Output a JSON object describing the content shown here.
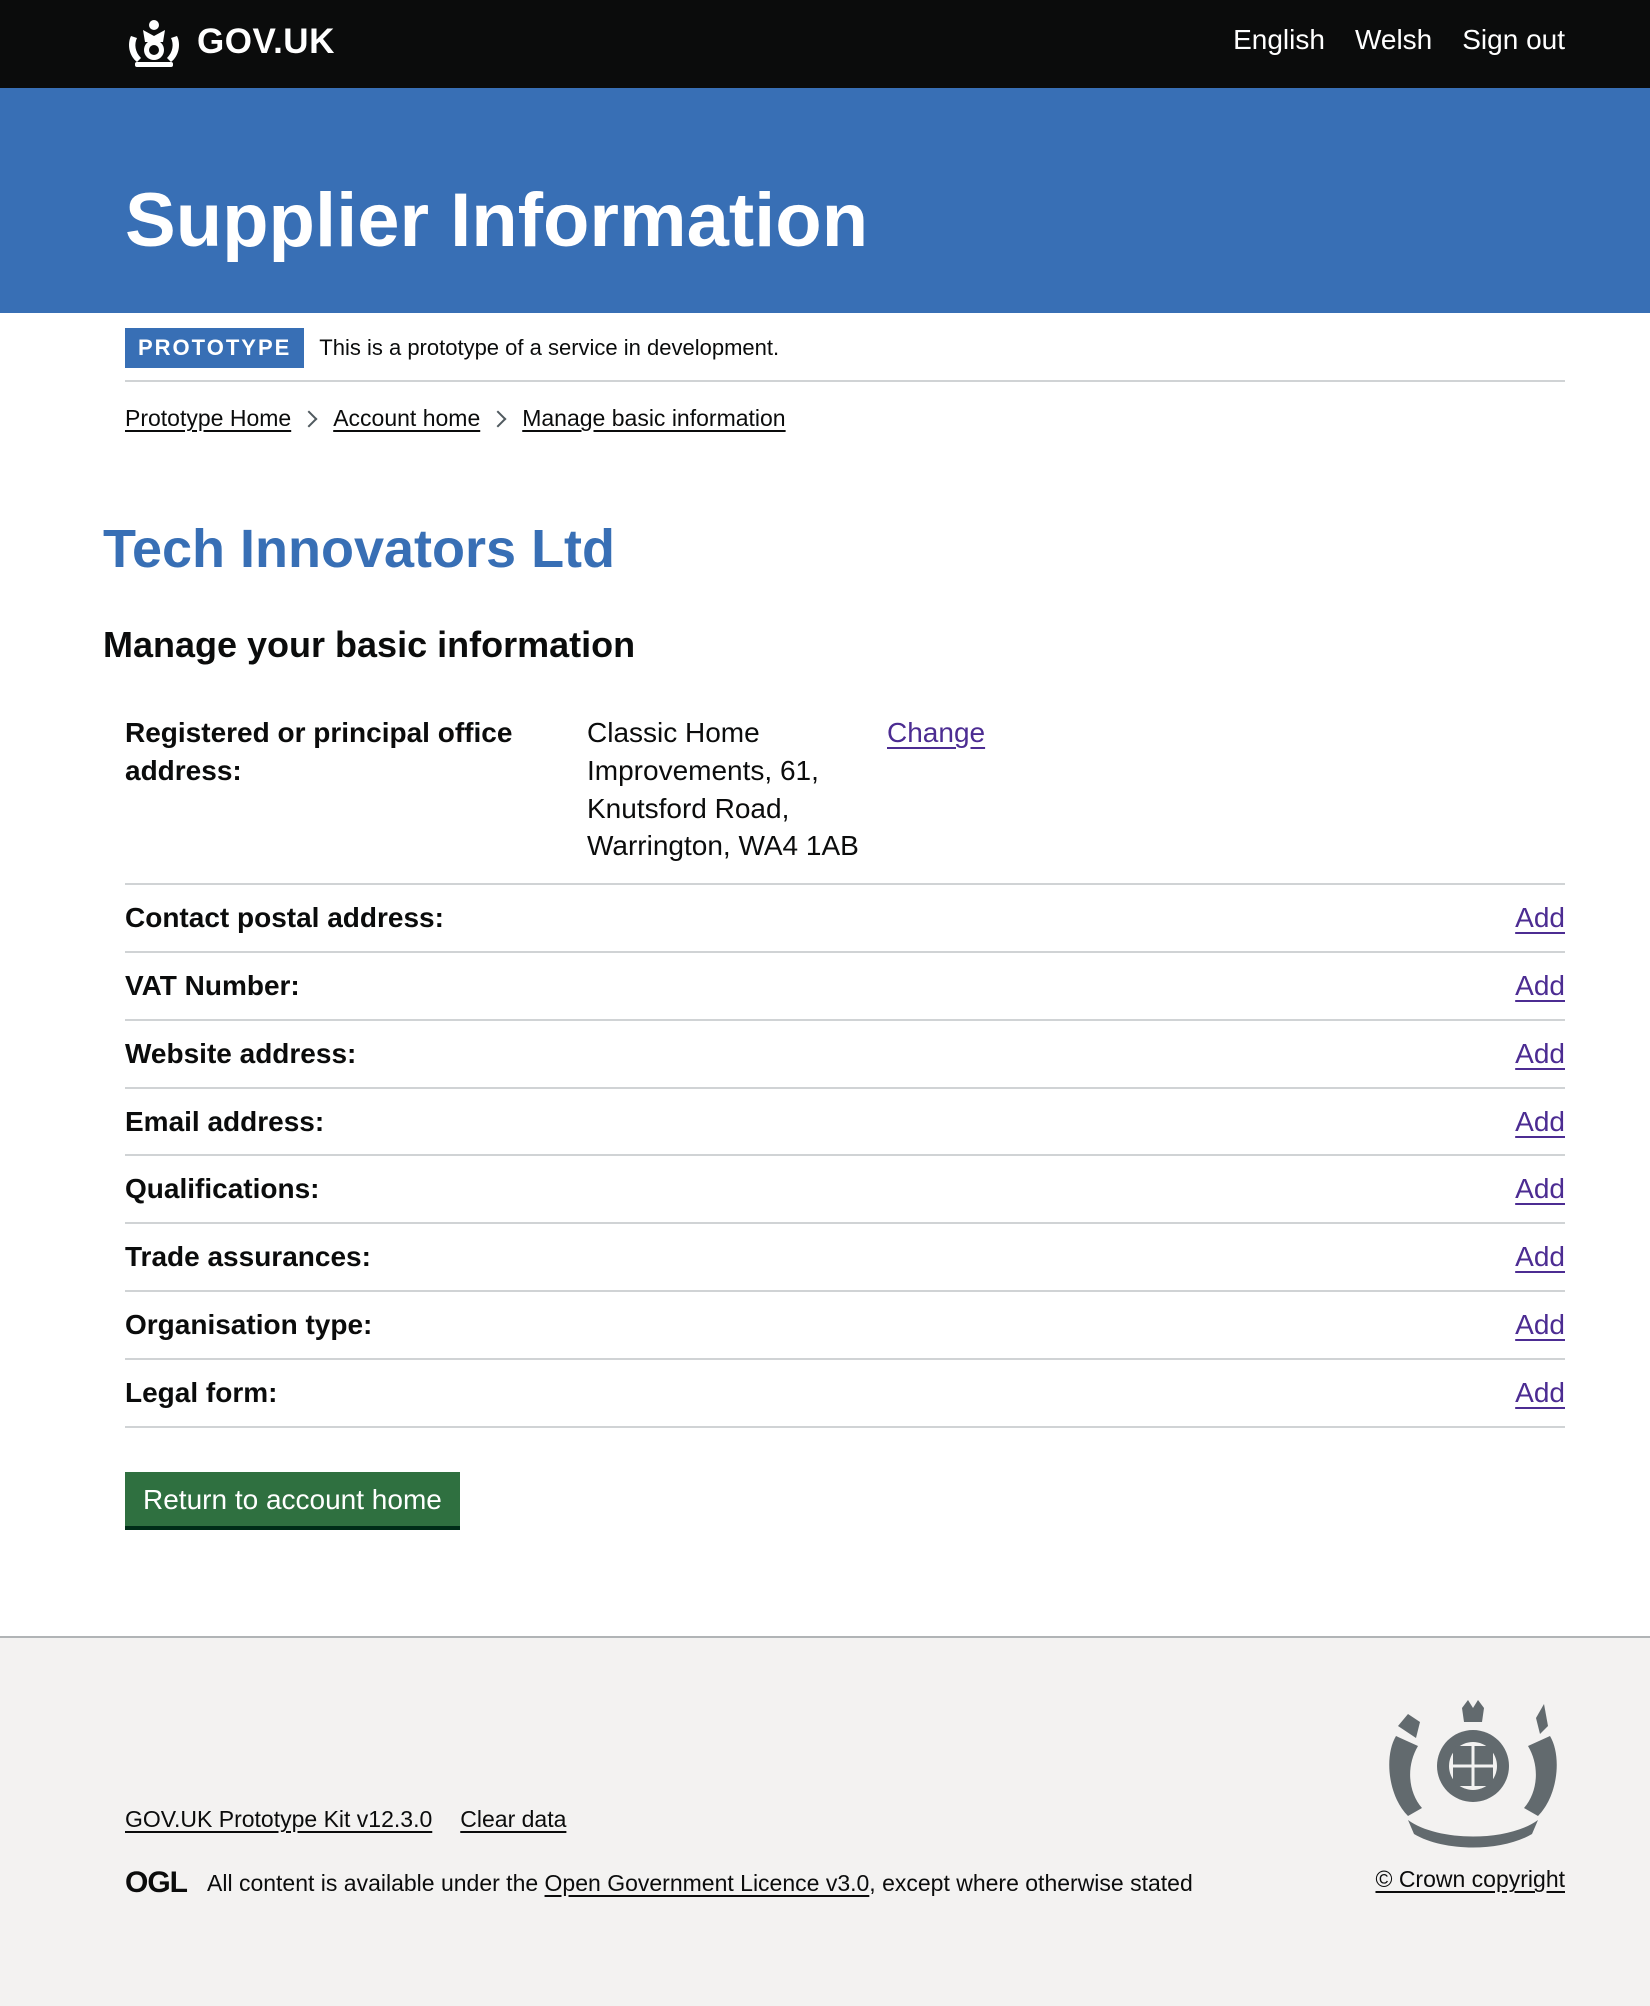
{
  "header": {
    "logo_text": "GOV.UK",
    "nav": [
      "English",
      "Welsh",
      "Sign out"
    ]
  },
  "banner": {
    "title": "Supplier Information"
  },
  "phase": {
    "tag": "PROTOTYPE",
    "text": "This is a prototype of a service in development."
  },
  "breadcrumbs": [
    "Prototype Home",
    "Account home",
    "Manage basic information"
  ],
  "organisation": "Tech Innovators Ltd",
  "section_title": "Manage your basic information",
  "summary": [
    {
      "key": "Registered or principal office address:",
      "value": "Classic Home Improvements, 61, Knutsford Road, Warrington, WA4 1AB",
      "action": "Change"
    },
    {
      "key": "Contact postal address:",
      "value": "",
      "action": "Add"
    },
    {
      "key": "VAT Number:",
      "value": "",
      "action": "Add"
    },
    {
      "key": "Website address:",
      "value": "",
      "action": "Add"
    },
    {
      "key": "Email address:",
      "value": "",
      "action": "Add"
    },
    {
      "key": "Qualifications:",
      "value": "",
      "action": "Add"
    },
    {
      "key": "Trade assurances:",
      "value": "",
      "action": "Add"
    },
    {
      "key": "Organisation type:",
      "value": "",
      "action": "Add"
    },
    {
      "key": "Legal form:",
      "value": "",
      "action": "Add"
    }
  ],
  "return_button": "Return to account home",
  "footer": {
    "links": [
      "GOV.UK Prototype Kit v12.3.0",
      "Clear data"
    ],
    "ogl": "OGL",
    "licence_prefix": "All content is available under the ",
    "licence_link": "Open Government Licence v3.0",
    "licence_suffix": ", except where otherwise stated",
    "copyright": "© Crown copyright"
  },
  "colors": {
    "header": "#0b0c0c",
    "brand_blue": "#386fb5",
    "button_green": "#2f7040",
    "link_purple": "#4c2c92",
    "footer_bg": "#f3f2f1"
  }
}
